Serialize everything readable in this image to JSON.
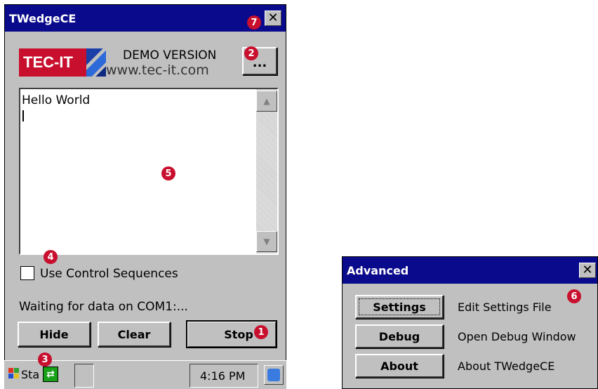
{
  "main_window": {
    "title": "TWedgeCE",
    "close_label": "✕",
    "logo_text": "TEC-IT",
    "demo_label": "DEMO VERSION",
    "url": "www.tec-it.com",
    "menu_button_label": "...",
    "text_area_lines": [
      "Hello World",
      "|"
    ],
    "checkbox_label": "Use Control Sequences",
    "checkbox_checked": false,
    "status_text": "Waiting for data on COM1:...",
    "buttons": {
      "hide": "Hide",
      "clear": "Clear",
      "stop": "Stop"
    }
  },
  "taskbar": {
    "start_label": "Sta",
    "clock": "4:16 PM"
  },
  "advanced_window": {
    "title": "Advanced",
    "close_label": "✕",
    "rows": [
      {
        "button": "Settings",
        "description": "Edit Settings File"
      },
      {
        "button": "Debug",
        "description": "Open Debug Window"
      },
      {
        "button": "About",
        "description": "About TWedgeCE"
      }
    ]
  },
  "badges": [
    "1",
    "2",
    "3",
    "4",
    "5",
    "6",
    "7"
  ],
  "colors": {
    "title_bar": "#0a0a8c",
    "badge": "#c8102e",
    "window": "#c0c0c0"
  }
}
